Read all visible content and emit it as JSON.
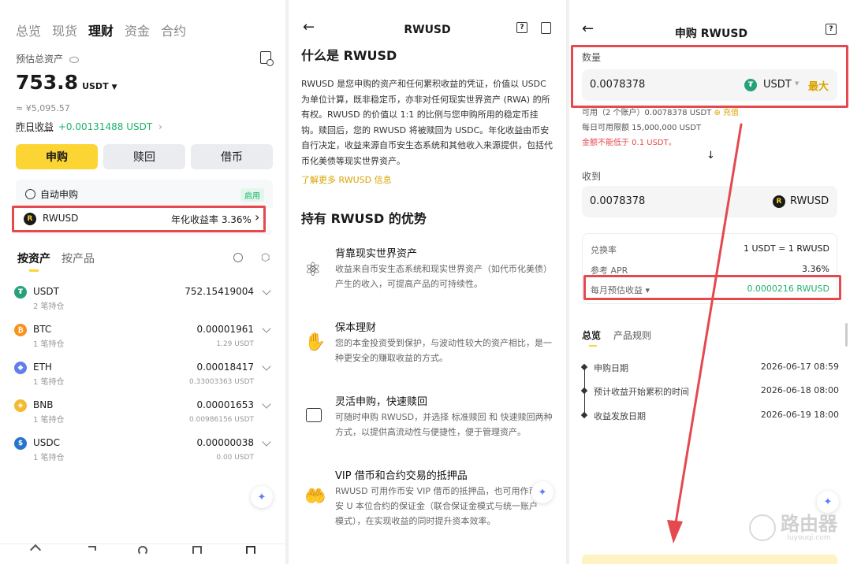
{
  "panel1": {
    "top_tabs": [
      "总览",
      "现货",
      "理财",
      "资金",
      "合约"
    ],
    "active_tab": 2,
    "est_assets_label": "预估总资产",
    "total_value": "753.8",
    "total_unit": "USDT",
    "cny_value": "≈ ¥5,095.57",
    "yesterday_label": "昨日收益",
    "yesterday_value": "+0.00131488 USDT",
    "buttons": [
      "申购",
      "赎回",
      "借币"
    ],
    "auto_sub_label": "自动申购",
    "auto_sub_status": "启用",
    "rwusd_name": "RWUSD",
    "rwusd_apr": "年化收益率 3.36%",
    "view_tabs": [
      "按资产",
      "按产品"
    ],
    "assets": [
      {
        "symbol": "USDT",
        "sub": "2 笔持仓",
        "amount": "752.15419004",
        "usdt": "",
        "color": "#26a17b",
        "glyph": "₮"
      },
      {
        "symbol": "BTC",
        "sub": "1 笔持仓",
        "amount": "0.00001961",
        "usdt": "1.29 USDT",
        "color": "#f7931a",
        "glyph": "₿"
      },
      {
        "symbol": "ETH",
        "sub": "1 笔持仓",
        "amount": "0.00018417",
        "usdt": "0.33003363 USDT",
        "color": "#627eea",
        "glyph": "◆"
      },
      {
        "symbol": "BNB",
        "sub": "1 笔持仓",
        "amount": "0.00001653",
        "usdt": "0.00986156 USDT",
        "color": "#f3ba2f",
        "glyph": "◈"
      },
      {
        "symbol": "USDC",
        "sub": "1 笔持仓",
        "amount": "0.00000038",
        "usdt": "0.00 USDT",
        "color": "#2775ca",
        "glyph": "$"
      }
    ]
  },
  "panel2": {
    "header_title": "RWUSD",
    "heading": "什么是 RWUSD",
    "intro": "RWUSD 是您申购的资产和任何累积收益的凭证，价值以 USDC 为单位计算，既非稳定币，亦非对任何现实世界资产 (RWA) 的所有权。RWUSD 的价值以 1:1 的比例与您申购所用的稳定币挂钩。赎回后，您的 RWUSD 将被赎回为 USDC。年化收益由币安自行决定，收益来源自币安生态系统和其他收入来源提供，包括代币化美债等现实世界资产。",
    "learn_more": "了解更多 RWUSD 信息",
    "adv_heading": "持有 RWUSD 的优势",
    "features": [
      {
        "title": "背靠现实世界资产",
        "desc": "收益来自币安生态系统和现实世界资产（如代币化美债）产生的收入，可提高产品的可持续性。"
      },
      {
        "title": "保本理财",
        "desc": "您的本金投资受到保护，与波动性较大的资产相比，是一种更安全的赚取收益的方式。"
      },
      {
        "title": "灵活申购，快速赎回",
        "desc": "可随时申购 RWUSD，并选择 标准赎回 和 快速赎回两种方式，以提供高流动性与便捷性，便于管理资产。"
      },
      {
        "title": "VIP 借币和合约交易的抵押品",
        "desc": "RWUSD 可用作币安 VIP 借币的抵押品，也可用作币安 U 本位合约的保证金（联合保证金模式与统一账户模式），在实现收益的同时提升资本效率。"
      }
    ]
  },
  "panel3": {
    "header_title": "申购 RWUSD",
    "qty_label": "数量",
    "qty_value": "0.0078378",
    "qty_token": "USDT",
    "max_label": "最大",
    "available_text": "可用（2 个账户）0.0078378 USDT",
    "topup_label": "充值",
    "daily_limit": "每日可用限额 15,000,000 USDT",
    "min_warning": "金额不能低于 0.1 USDT。",
    "receive_label": "收到",
    "receive_value": "0.0078378",
    "receive_token": "RWUSD",
    "rate_label": "兑换率",
    "rate_value": "1 USDT = 1 RWUSD",
    "apr_label": "参考 APR",
    "apr_value": "3.36%",
    "monthly_label": "每月预估收益",
    "monthly_value": "0.0000216 RWUSD",
    "tabs": [
      "总览",
      "产品规则"
    ],
    "timeline": [
      {
        "label": "申购日期",
        "value": "2026-06-17 08:59"
      },
      {
        "label": "预计收益开始累积的时间",
        "value": "2026-06-18 08:00"
      },
      {
        "label": "收益发放日期",
        "value": "2026-06-19 18:00"
      }
    ],
    "watermark_cn": "路由器",
    "watermark_en": "luyouqi.com"
  },
  "colors": {
    "accent_yellow": "#fcd535",
    "green": "#1db26b",
    "annotation_red": "#e5484d"
  }
}
